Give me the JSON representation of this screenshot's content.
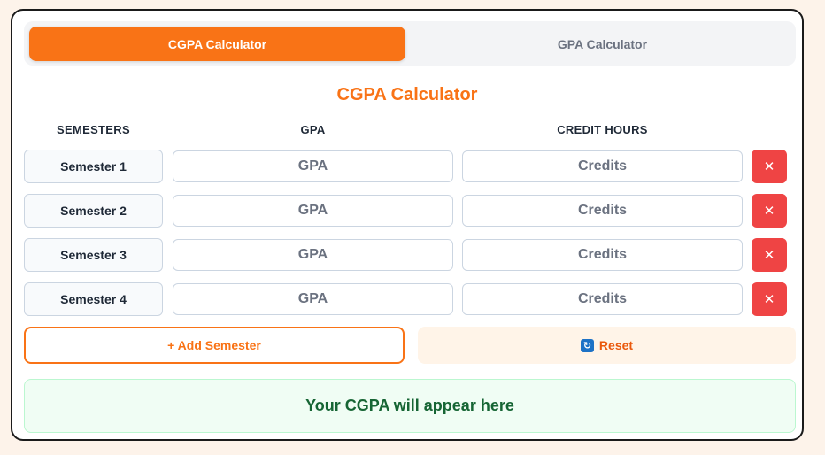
{
  "colors": {
    "accent": "#f97316",
    "danger": "#ef4444",
    "success_text": "#166534",
    "success_bg": "#f0fdf4",
    "page_bg": "#fdf3ea"
  },
  "tabs": [
    {
      "label": "CGPA Calculator",
      "active": true
    },
    {
      "label": "GPA Calculator",
      "active": false
    }
  ],
  "title": "CGPA Calculator",
  "columns": {
    "semesters": "SEMESTERS",
    "gpa": "GPA",
    "credits": "CREDIT HOURS"
  },
  "rows": [
    {
      "label": "Semester 1",
      "gpa_value": "",
      "gpa_placeholder": "GPA",
      "credits_value": "",
      "credits_placeholder": "Credits",
      "delete_label": "✕"
    },
    {
      "label": "Semester 2",
      "gpa_value": "",
      "gpa_placeholder": "GPA",
      "credits_value": "",
      "credits_placeholder": "Credits",
      "delete_label": "✕"
    },
    {
      "label": "Semester 3",
      "gpa_value": "",
      "gpa_placeholder": "GPA",
      "credits_value": "",
      "credits_placeholder": "Credits",
      "delete_label": "✕"
    },
    {
      "label": "Semester 4",
      "gpa_value": "",
      "gpa_placeholder": "GPA",
      "credits_value": "",
      "credits_placeholder": "Credits",
      "delete_label": "✕"
    }
  ],
  "actions": {
    "add_label": "+ Add Semester",
    "reset_label": "Reset",
    "reset_icon": "refresh-icon"
  },
  "result": {
    "text": "Your CGPA will appear here"
  }
}
